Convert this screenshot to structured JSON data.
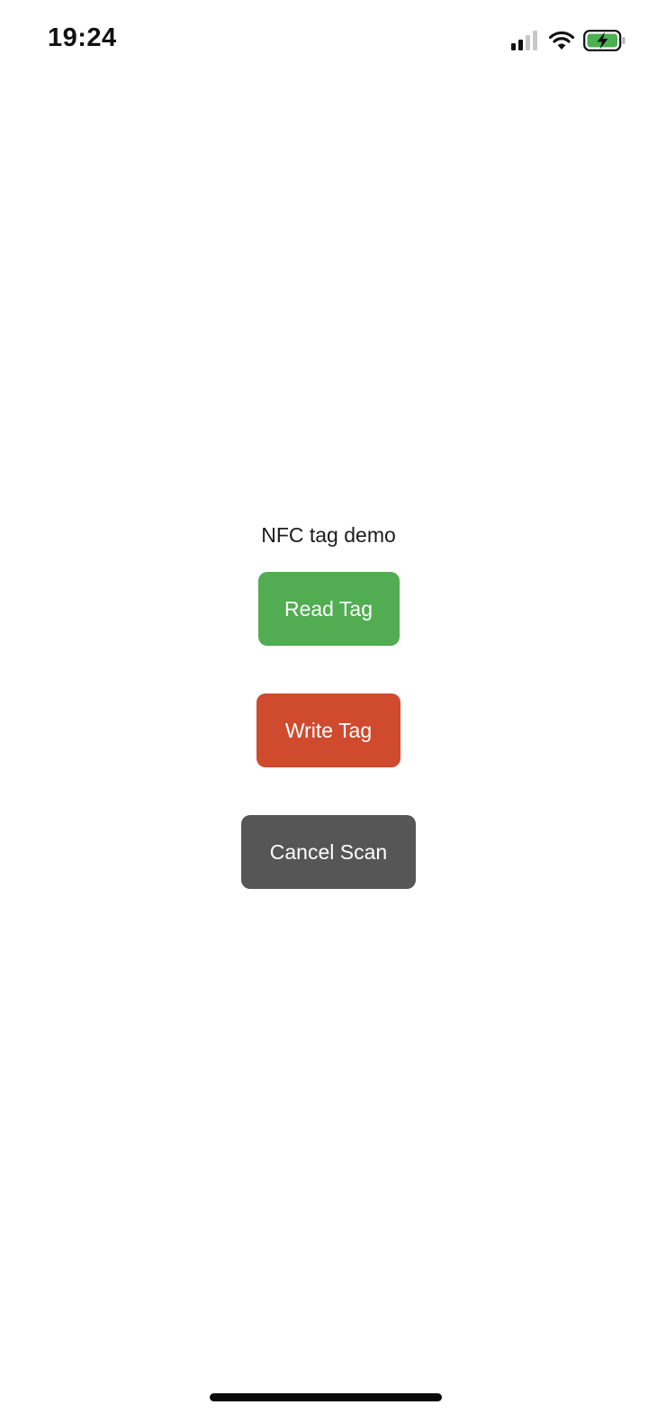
{
  "status_bar": {
    "time": "19:24",
    "icons": [
      "cellular-signal-icon",
      "wifi-icon",
      "battery-charging-icon"
    ]
  },
  "main": {
    "title": "NFC tag demo",
    "buttons": {
      "read_label": "Read Tag",
      "write_label": "Write Tag",
      "cancel_label": "Cancel Scan"
    }
  },
  "colors": {
    "read_button": "#52ad52",
    "write_button": "#d04a2e",
    "cancel_button": "#565656",
    "battery_fill": "#4caf50"
  }
}
